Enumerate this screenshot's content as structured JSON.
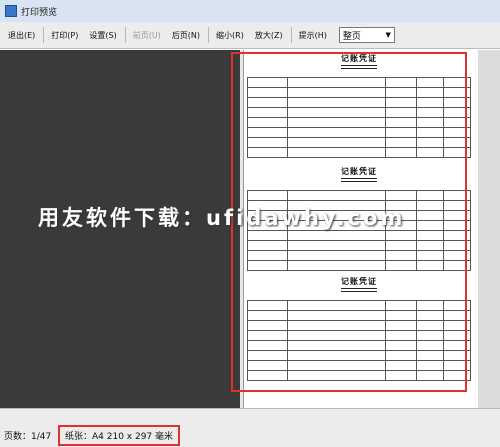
{
  "window": {
    "title": "打印预览"
  },
  "toolbar": {
    "buttons": [
      {
        "label": "退出(E)",
        "enabled": true
      },
      {
        "label": "打印(P)",
        "enabled": true
      },
      {
        "label": "设置(S)",
        "enabled": true
      },
      {
        "label": "前页(U)",
        "enabled": false
      },
      {
        "label": "后页(N)",
        "enabled": true
      },
      {
        "label": "缩小(R)",
        "enabled": true
      },
      {
        "label": "放大(Z)",
        "enabled": true
      },
      {
        "label": "提示(H)",
        "enabled": true
      }
    ],
    "zoom_value": "整页"
  },
  "vouchers": [
    {
      "title": "记账凭证",
      "rows": [
        [
          "",
          "",
          "",
          "",
          ""
        ],
        [
          "",
          "",
          "",
          "",
          ""
        ],
        [
          "",
          "",
          "",
          "",
          ""
        ],
        [
          "",
          "",
          "",
          "",
          ""
        ],
        [
          "",
          "",
          "",
          "",
          ""
        ],
        [
          "",
          "",
          "",
          "",
          ""
        ],
        [
          "",
          "",
          "",
          "",
          ""
        ],
        [
          "",
          "",
          "",
          "",
          ""
        ]
      ]
    },
    {
      "title": "记账凭证",
      "rows": [
        [
          "",
          "",
          "",
          "",
          ""
        ],
        [
          "",
          "",
          "",
          "",
          ""
        ],
        [
          "",
          "",
          "",
          "",
          ""
        ],
        [
          "",
          "",
          "",
          "",
          ""
        ],
        [
          "",
          "",
          "",
          "",
          ""
        ],
        [
          "",
          "",
          "",
          "",
          ""
        ],
        [
          "",
          "",
          "",
          "",
          ""
        ],
        [
          "",
          "",
          "",
          "",
          ""
        ]
      ]
    },
    {
      "title": "记账凭证",
      "rows": [
        [
          "",
          "",
          "",
          "",
          ""
        ],
        [
          "",
          "",
          "",
          "",
          ""
        ],
        [
          "",
          "",
          "",
          "",
          ""
        ],
        [
          "",
          "",
          "",
          "",
          ""
        ],
        [
          "",
          "",
          "",
          "",
          ""
        ],
        [
          "",
          "",
          "",
          "",
          ""
        ],
        [
          "",
          "",
          "",
          "",
          ""
        ],
        [
          "",
          "",
          "",
          "",
          ""
        ]
      ]
    }
  ],
  "watermark": "用友软件下载：ufidawhy.com",
  "status": {
    "pages": "页数：1/47",
    "paper": "纸张：A4 210 x 297 毫米"
  },
  "colors": {
    "highlight": "#e03030",
    "dark_panel": "#3a3a3a"
  }
}
